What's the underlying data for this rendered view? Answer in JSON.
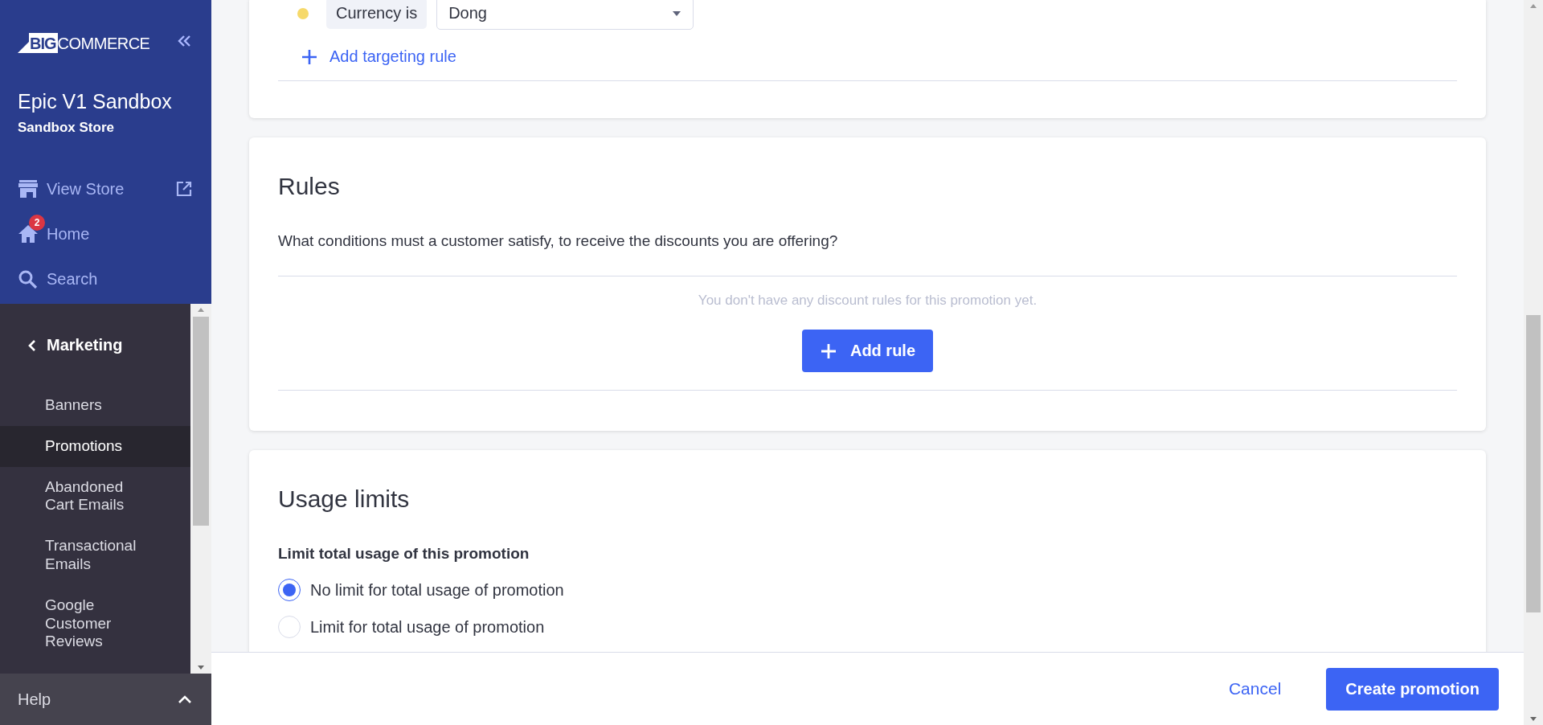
{
  "sidebar": {
    "logo": {
      "prefix": "BIG",
      "word": "COMMERCE"
    },
    "store_name": "Epic V1 Sandbox",
    "store_type": "Sandbox Store",
    "nav": [
      {
        "kind": "store",
        "label": "View Store"
      },
      {
        "kind": "home",
        "label": "Home",
        "badge": "2"
      },
      {
        "kind": "search",
        "label": "Search"
      }
    ],
    "section": "Marketing",
    "items": [
      {
        "label": "Banners",
        "selected": false
      },
      {
        "label": "Promotions",
        "selected": true
      },
      {
        "label": "Abandoned Cart Emails",
        "selected": false
      },
      {
        "label": "Transactional Emails",
        "selected": false
      },
      {
        "label": "Google Customer Reviews",
        "selected": false
      }
    ],
    "help": "Help"
  },
  "targeting": {
    "condition": "Currency is",
    "value": "Dong",
    "add_link": "Add targeting rule"
  },
  "rules": {
    "title": "Rules",
    "description": "What conditions must a customer satisfy, to receive the discounts you are offering?",
    "empty_text": "You don't have any discount rules for this promotion yet.",
    "button": "Add rule"
  },
  "usage_limits": {
    "title": "Usage limits",
    "label": "Limit total usage of this promotion",
    "options": [
      {
        "label": "No limit for total usage of promotion",
        "selected": true
      },
      {
        "label": "Limit for total usage of promotion",
        "selected": false
      }
    ]
  },
  "footer": {
    "cancel": "Cancel",
    "submit": "Create promotion"
  }
}
